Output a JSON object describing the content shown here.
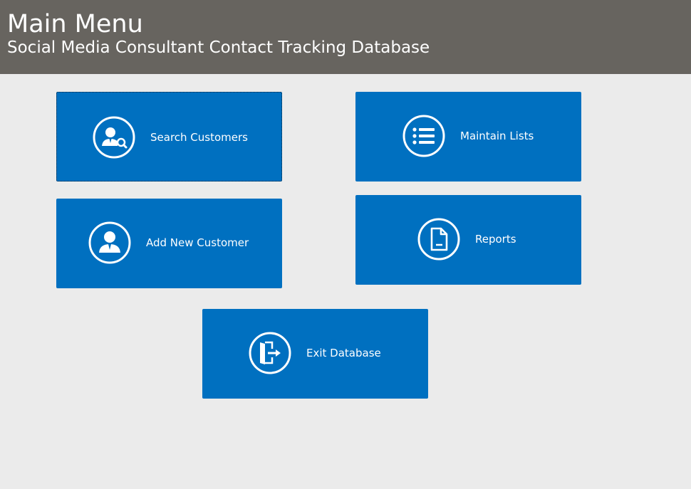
{
  "header": {
    "title": "Main Menu",
    "subtitle": "Social Media Consultant Contact Tracking Database"
  },
  "tiles": {
    "search_customers": {
      "label": "Search Customers",
      "icon": "user-search-icon"
    },
    "maintain_lists": {
      "label": "Maintain Lists",
      "icon": "list-icon"
    },
    "add_new_customer": {
      "label": "Add New Customer",
      "icon": "user-icon"
    },
    "reports": {
      "label": "Reports",
      "icon": "document-icon"
    },
    "exit_database": {
      "label": "Exit Database",
      "icon": "exit-door-icon"
    }
  },
  "colors": {
    "header_bg": "#67645f",
    "page_bg": "#ebebeb",
    "tile_bg": "#0070c0",
    "text": "#ffffff"
  }
}
